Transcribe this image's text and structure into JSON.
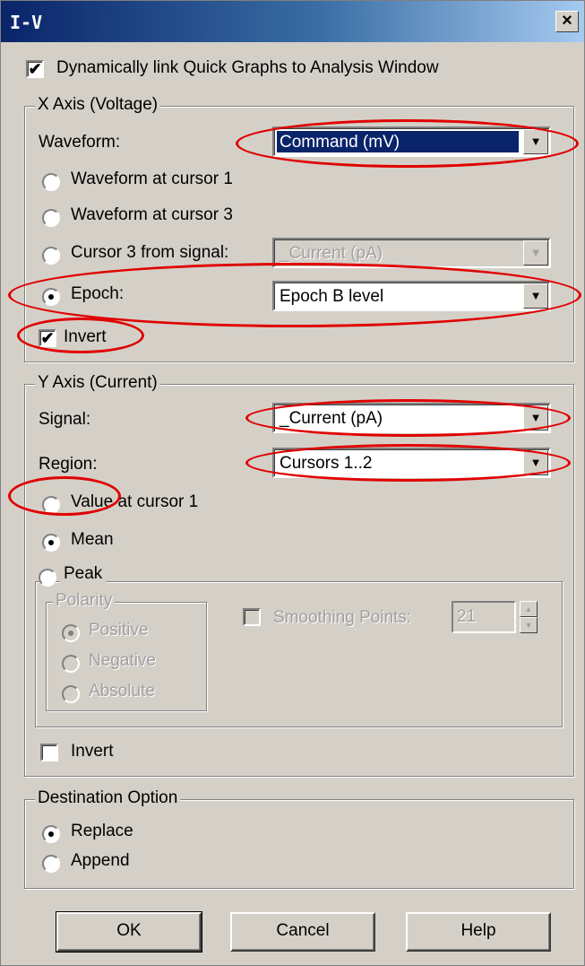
{
  "title": "I-V",
  "close_label": "×",
  "check_mark": "✔",
  "link_checkbox": {
    "label": "Dynamically link Quick Graphs to Analysis Window",
    "checked": true
  },
  "x_axis": {
    "legend": "X Axis (Voltage)",
    "waveform_label": "Waveform:",
    "waveform_value": "Command (mV)",
    "radio_cursor1": "Waveform at cursor 1",
    "radio_cursor3": "Waveform at cursor 3",
    "radio_signal": "Cursor 3 from signal:",
    "signal_value": "_Current (pA)",
    "radio_epoch": "Epoch:",
    "epoch_value": "Epoch B level",
    "invert_label": "Invert",
    "invert_checked": true
  },
  "y_axis": {
    "legend": "Y Axis (Current)",
    "signal_label": "Signal:",
    "signal_value": "_Current (pA)",
    "region_label": "Region:",
    "region_value": "Cursors 1..2",
    "radio_value_cursor": "Value at cursor 1",
    "radio_mean": "Mean",
    "radio_peak": "Peak",
    "polarity_legend": "Polarity",
    "polarity_positive": "Positive",
    "polarity_negative": "Negative",
    "polarity_absolute": "Absolute",
    "smoothing_label": "Smoothing Points:",
    "smoothing_value": "21",
    "invert_label": "Invert",
    "invert_checked": false
  },
  "destination": {
    "legend": "Destination Option",
    "replace": "Replace",
    "append": "Append"
  },
  "buttons": {
    "ok": "OK",
    "cancel": "Cancel",
    "help": "Help"
  },
  "annotation_color": "#e00000"
}
